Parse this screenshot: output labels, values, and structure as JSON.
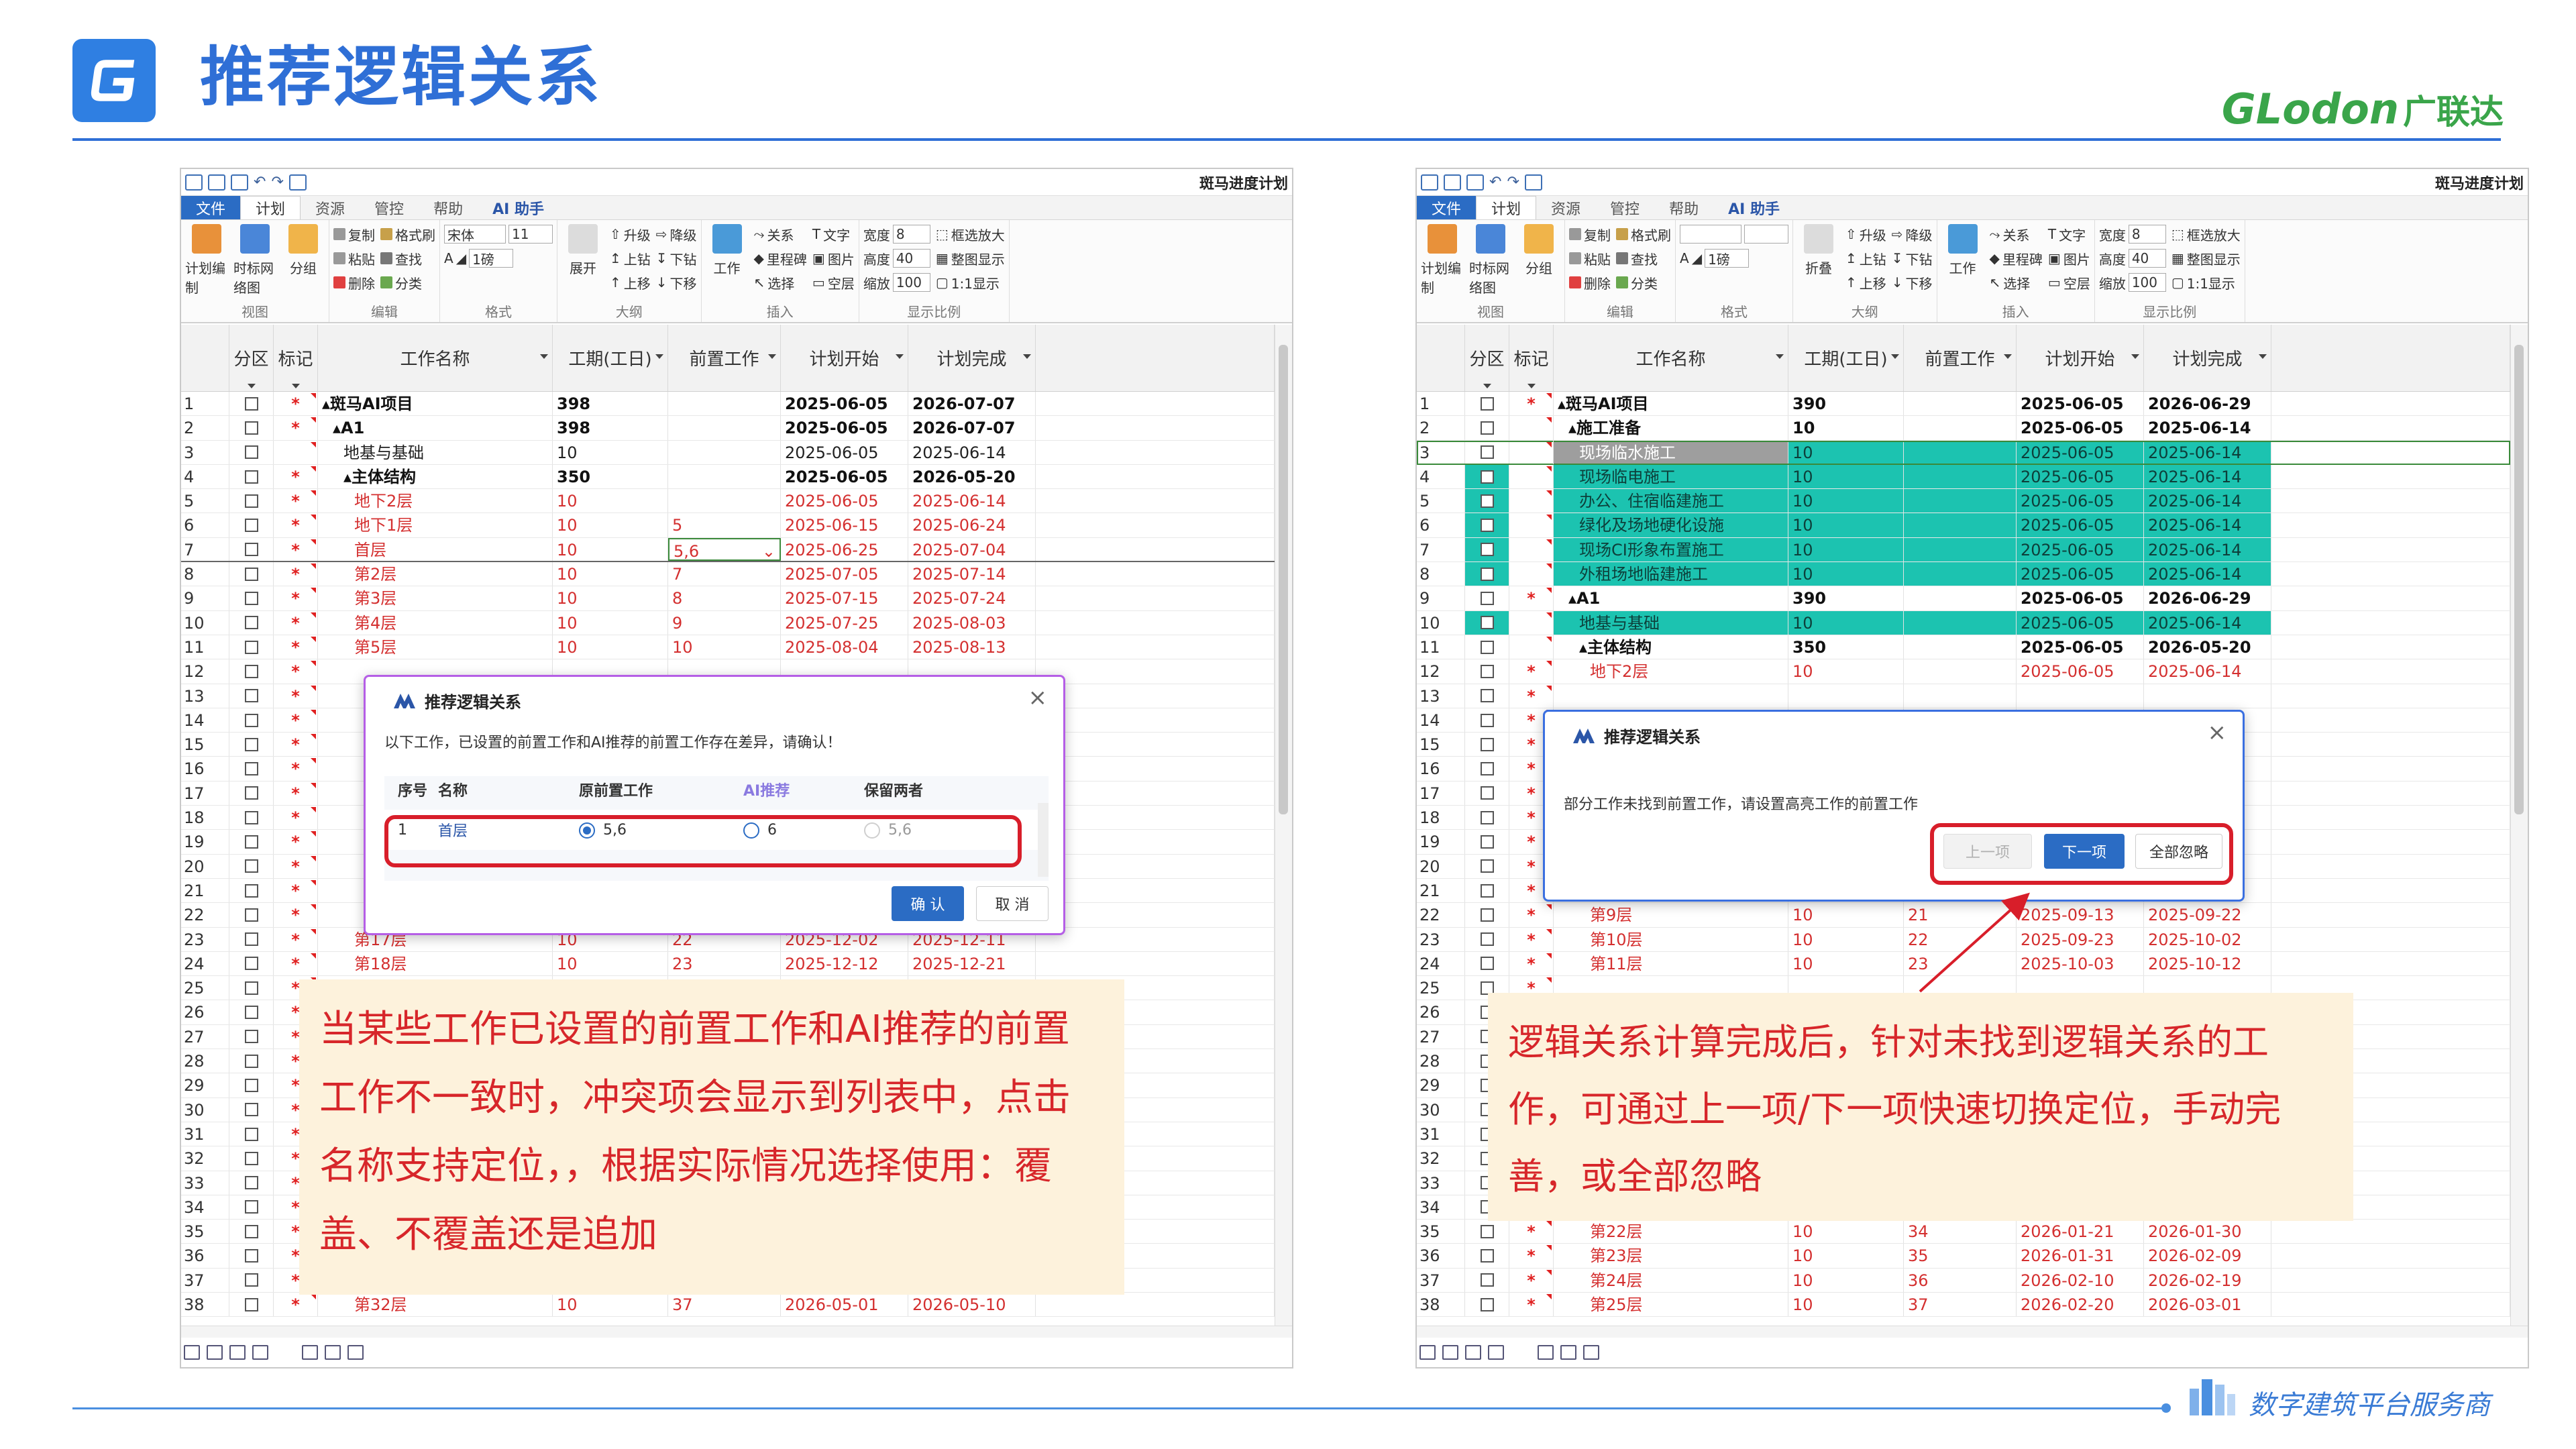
{
  "slide": {
    "title": "推荐逻辑关系",
    "brand_latin": "GLodon",
    "brand_cn": "广联达",
    "footer": "数字建筑平台服务商"
  },
  "app": {
    "doc_title": "斑马进度计划",
    "menu_tabs": [
      "文件",
      "计划",
      "资源",
      "管控",
      "帮助"
    ],
    "ai_tab": "AI 助手",
    "ribbon": {
      "view": {
        "label": "视图",
        "items": [
          "计划编制",
          "时标网络图",
          "分组"
        ]
      },
      "edit": {
        "label": "编辑",
        "items": [
          "复制",
          "粘贴",
          "删除",
          "格式刷",
          "查找",
          "分类"
        ]
      },
      "format": {
        "label": "格式",
        "font_left": "宋体",
        "size_left": "11",
        "font_right": "",
        "size_right": "",
        "weight": "1磅"
      },
      "outline": {
        "label": "大纲",
        "items": [
          "展开",
          "升级",
          "降级",
          "上钻",
          "下钻",
          "上移",
          "下移"
        ],
        "fold": "折叠"
      },
      "insert": {
        "label": "插入",
        "items": [
          "工作",
          "关系",
          "里程碑",
          "选择",
          "文字",
          "图片",
          "空层"
        ]
      },
      "scale": {
        "label": "显示比例",
        "items": [
          "宽度",
          "高度",
          "缩放",
          "框选放大",
          "整图显示",
          "1:1显示"
        ],
        "width_val": "8",
        "height_val": "40",
        "zoom_val": "100"
      }
    },
    "columns": [
      "分区",
      "标记",
      "工作名称",
      "工期(工日)",
      "前置工作",
      "计划开始",
      "计划完成"
    ]
  },
  "left": {
    "rows": [
      {
        "n": "1",
        "mark": "*",
        "name": "▴斑马AI项目",
        "indent": 0,
        "dur": "398",
        "pred": "",
        "start": "2025-06-05",
        "end": "2026-07-07",
        "style": "bold"
      },
      {
        "n": "2",
        "mark": "*",
        "name": "▴A1",
        "indent": 1,
        "dur": "398",
        "pred": "",
        "start": "2025-06-05",
        "end": "2026-07-07",
        "style": "bold"
      },
      {
        "n": "3",
        "mark": "",
        "name": "地基与基础",
        "indent": 2,
        "dur": "10",
        "pred": "",
        "start": "2025-06-05",
        "end": "2025-06-14",
        "style": ""
      },
      {
        "n": "4",
        "mark": "*",
        "name": "▴主体结构",
        "indent": 2,
        "dur": "350",
        "pred": "",
        "start": "2025-06-05",
        "end": "2026-05-20",
        "style": "bold"
      },
      {
        "n": "5",
        "mark": "*",
        "name": "地下2层",
        "indent": 3,
        "dur": "10",
        "pred": "",
        "start": "2025-06-05",
        "end": "2025-06-14",
        "style": "red"
      },
      {
        "n": "6",
        "mark": "*",
        "name": "地下1层",
        "indent": 3,
        "dur": "10",
        "pred": "5",
        "start": "2025-06-15",
        "end": "2025-06-24",
        "style": "red"
      },
      {
        "n": "7",
        "mark": "*",
        "name": "首层",
        "indent": 3,
        "dur": "10",
        "pred": "5,6",
        "start": "2025-06-25",
        "end": "2025-07-04",
        "style": "red edit"
      },
      {
        "n": "8",
        "mark": "*",
        "name": "第2层",
        "indent": 3,
        "dur": "10",
        "pred": "7",
        "start": "2025-07-05",
        "end": "2025-07-14",
        "style": "red"
      },
      {
        "n": "9",
        "mark": "*",
        "name": "第3层",
        "indent": 3,
        "dur": "10",
        "pred": "8",
        "start": "2025-07-15",
        "end": "2025-07-24",
        "style": "red"
      },
      {
        "n": "10",
        "mark": "*",
        "name": "第4层",
        "indent": 3,
        "dur": "10",
        "pred": "9",
        "start": "2025-07-25",
        "end": "2025-08-03",
        "style": "red"
      },
      {
        "n": "11",
        "mark": "*",
        "name": "第5层",
        "indent": 3,
        "dur": "10",
        "pred": "10",
        "start": "2025-08-04",
        "end": "2025-08-13",
        "style": "red"
      },
      {
        "n": "12",
        "mark": "*"
      },
      {
        "n": "13",
        "mark": "*"
      },
      {
        "n": "14",
        "mark": "*"
      },
      {
        "n": "15",
        "mark": "*"
      },
      {
        "n": "16",
        "mark": "*"
      },
      {
        "n": "17",
        "mark": "*"
      },
      {
        "n": "18",
        "mark": "*"
      },
      {
        "n": "19",
        "mark": "*"
      },
      {
        "n": "20",
        "mark": "*"
      },
      {
        "n": "21",
        "mark": "*"
      },
      {
        "n": "22",
        "mark": "*"
      },
      {
        "n": "23",
        "mark": "*",
        "name": "第17层",
        "indent": 3,
        "dur": "10",
        "pred": "22",
        "start": "2025-12-02",
        "end": "2025-12-11",
        "style": "red"
      },
      {
        "n": "24",
        "mark": "*",
        "name": "第18层",
        "indent": 3,
        "dur": "10",
        "pred": "23",
        "start": "2025-12-12",
        "end": "2025-12-21",
        "style": "red"
      },
      {
        "n": "25",
        "mark": "*"
      },
      {
        "n": "26",
        "mark": "*"
      },
      {
        "n": "27",
        "mark": "*"
      },
      {
        "n": "28",
        "mark": "*"
      },
      {
        "n": "29",
        "mark": "*"
      },
      {
        "n": "30",
        "mark": "*"
      },
      {
        "n": "31",
        "mark": "*"
      },
      {
        "n": "32",
        "mark": "*"
      },
      {
        "n": "33",
        "mark": "*"
      },
      {
        "n": "34",
        "mark": "*"
      },
      {
        "n": "35",
        "mark": "*"
      },
      {
        "n": "36",
        "mark": "*"
      },
      {
        "n": "37",
        "mark": "*"
      },
      {
        "n": "38",
        "mark": "*",
        "name": "第32层",
        "indent": 3,
        "dur": "10",
        "pred": "37",
        "start": "2026-05-01",
        "end": "2026-05-10",
        "style": "red"
      }
    ],
    "dialog": {
      "title": "推荐逻辑关系",
      "message": "以下工作，已设置的前置工作和AI推荐的前置工作存在差异，请确认！",
      "headers": [
        "序号",
        "名称",
        "原前置工作",
        "AI推荐",
        "保留两者"
      ],
      "row": {
        "seq": "1",
        "name": "首层",
        "orig": "5,6",
        "ai": "6",
        "both": "5,6"
      },
      "ok": "确 认",
      "cancel": "取 消"
    },
    "note": "当某些工作已设置的前置工作和AI推荐的前置工作不一致时，冲突项会显示到列表中，点击名称支持定位，，根据实际情况选择使用：覆盖、不覆盖还是追加"
  },
  "right": {
    "rows": [
      {
        "n": "1",
        "mark": "*",
        "name": "▴斑马AI项目",
        "indent": 0,
        "dur": "390",
        "pred": "",
        "start": "2025-06-05",
        "end": "2026-06-29",
        "style": "bold"
      },
      {
        "n": "2",
        "mark": "",
        "name": "▴施工准备",
        "indent": 1,
        "dur": "10",
        "pred": "",
        "start": "2025-06-05",
        "end": "2025-06-14",
        "style": "bold"
      },
      {
        "n": "3",
        "mark": "",
        "name": "现场临水施工",
        "indent": 2,
        "dur": "10",
        "pred": "",
        "start": "2025-06-05",
        "end": "2025-06-14",
        "style": "grey sel"
      },
      {
        "n": "4",
        "mark": "",
        "name": "现场临电施工",
        "indent": 2,
        "dur": "10",
        "pred": "",
        "start": "2025-06-05",
        "end": "2025-06-14",
        "style": "teal"
      },
      {
        "n": "5",
        "mark": "",
        "name": "办公、住宿临建施工",
        "indent": 2,
        "dur": "10",
        "pred": "",
        "start": "2025-06-05",
        "end": "2025-06-14",
        "style": "teal"
      },
      {
        "n": "6",
        "mark": "",
        "name": "绿化及场地硬化设施",
        "indent": 2,
        "dur": "10",
        "pred": "",
        "start": "2025-06-05",
        "end": "2025-06-14",
        "style": "teal"
      },
      {
        "n": "7",
        "mark": "",
        "name": "现场CI形象布置施工",
        "indent": 2,
        "dur": "10",
        "pred": "",
        "start": "2025-06-05",
        "end": "2025-06-14",
        "style": "teal"
      },
      {
        "n": "8",
        "mark": "",
        "name": "外租场地临建施工",
        "indent": 2,
        "dur": "10",
        "pred": "",
        "start": "2025-06-05",
        "end": "2025-06-14",
        "style": "teal"
      },
      {
        "n": "9",
        "mark": "*",
        "name": "▴A1",
        "indent": 1,
        "dur": "390",
        "pred": "",
        "start": "2025-06-05",
        "end": "2026-06-29",
        "style": "bold"
      },
      {
        "n": "10",
        "mark": "",
        "name": "地基与基础",
        "indent": 2,
        "dur": "10",
        "pred": "",
        "start": "2025-06-05",
        "end": "2025-06-14",
        "style": "teal"
      },
      {
        "n": "11",
        "mark": "",
        "name": "▴主体结构",
        "indent": 2,
        "dur": "350",
        "pred": "",
        "start": "2025-06-05",
        "end": "2026-05-20",
        "style": "bold"
      },
      {
        "n": "12",
        "mark": "*",
        "name": "地下2层",
        "indent": 3,
        "dur": "10",
        "pred": "",
        "start": "2025-06-05",
        "end": "2025-06-14",
        "style": "red"
      },
      {
        "n": "13",
        "mark": "*"
      },
      {
        "n": "14",
        "mark": "*"
      },
      {
        "n": "15",
        "mark": "*"
      },
      {
        "n": "16",
        "mark": "*"
      },
      {
        "n": "17",
        "mark": "*"
      },
      {
        "n": "18",
        "mark": "*"
      },
      {
        "n": "19",
        "mark": "*"
      },
      {
        "n": "20",
        "mark": "*"
      },
      {
        "n": "21",
        "mark": "*"
      },
      {
        "n": "22",
        "mark": "*",
        "name": "第9层",
        "indent": 3,
        "dur": "10",
        "pred": "21",
        "start": "2025-09-13",
        "end": "2025-09-22",
        "style": "red"
      },
      {
        "n": "23",
        "mark": "*",
        "name": "第10层",
        "indent": 3,
        "dur": "10",
        "pred": "22",
        "start": "2025-09-23",
        "end": "2025-10-02",
        "style": "red"
      },
      {
        "n": "24",
        "mark": "*",
        "name": "第11层",
        "indent": 3,
        "dur": "10",
        "pred": "23",
        "start": "2025-10-03",
        "end": "2025-10-12",
        "style": "red"
      },
      {
        "n": "25",
        "mark": "*"
      },
      {
        "n": "26",
        "mark": "*"
      },
      {
        "n": "27",
        "mark": "*"
      },
      {
        "n": "28",
        "mark": "*"
      },
      {
        "n": "29",
        "mark": "*"
      },
      {
        "n": "30",
        "mark": "*"
      },
      {
        "n": "31",
        "mark": "*"
      },
      {
        "n": "32",
        "mark": "*"
      },
      {
        "n": "33",
        "mark": "*"
      },
      {
        "n": "34",
        "mark": "*"
      },
      {
        "n": "35",
        "mark": "*",
        "name": "第22层",
        "indent": 3,
        "dur": "10",
        "pred": "34",
        "start": "2026-01-21",
        "end": "2026-01-30",
        "style": "red"
      },
      {
        "n": "36",
        "mark": "*",
        "name": "第23层",
        "indent": 3,
        "dur": "10",
        "pred": "35",
        "start": "2026-01-31",
        "end": "2026-02-09",
        "style": "red"
      },
      {
        "n": "37",
        "mark": "*",
        "name": "第24层",
        "indent": 3,
        "dur": "10",
        "pred": "36",
        "start": "2026-02-10",
        "end": "2026-02-19",
        "style": "red"
      },
      {
        "n": "38",
        "mark": "*",
        "name": "第25层",
        "indent": 3,
        "dur": "10",
        "pred": "37",
        "start": "2026-02-20",
        "end": "2026-03-01",
        "style": "red"
      }
    ],
    "dialog": {
      "title": "推荐逻辑关系",
      "message": "部分工作未找到前置工作，请设置高亮工作的前置工作",
      "prev": "上一项",
      "next": "下一项",
      "ignore_all": "全部忽略"
    },
    "note": "逻辑关系计算完成后，针对未找到逻辑关系的工作，可通过上一项/下一项快速切换定位，手动完善，或全部忽略"
  },
  "colors": {
    "title_blue": "#2f6fd6",
    "brand_green": "#3aa54a",
    "note_red": "#d7262a",
    "note_bg": "#fdf2dc",
    "highlight_teal": "#1cc3b0",
    "frame_red": "#d81e2a"
  }
}
